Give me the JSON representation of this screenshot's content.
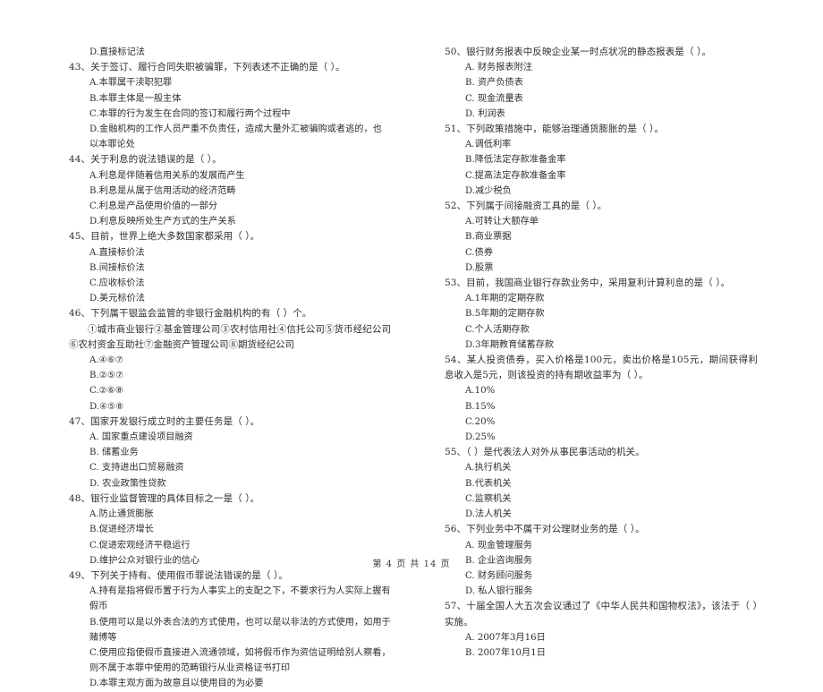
{
  "document": {
    "footer": "第 4 页  共 14 页",
    "page_number": "4",
    "total_pages": "14"
  },
  "left_column": {
    "orphan_option": "D.直接标记法",
    "questions": [
      {
        "number": "43、",
        "stem": "关于签订、履行合同失职被骗罪，下列表述不正确的是（      ）。",
        "options": [
          "A.本罪属干渎职犯罪",
          "B.本罪主体是一般主体",
          "C.本罪的行为发生在合同的签订和履行两个过程中",
          "D.金融机构的工作人员严重不负责任，造成大量外汇被骗购或者逃的，也以本罪论处"
        ]
      },
      {
        "number": "44、",
        "stem": "关于利息的说法错误的是（      ）。",
        "options": [
          "A.利息是伴随着信用关系的发展而产生",
          "B.利息是从属于信用活动的经济范畴",
          "C.利息是产品使用价值的一部分",
          "D.利息反映所处生产方式的生产关系"
        ]
      },
      {
        "number": "45、",
        "stem": "目前，世界上绝大多数国家都采用（      ）。",
        "options": [
          "A.直接标价法",
          "B.间接标价法",
          "C.应收标价法",
          "D.美元标价法"
        ]
      },
      {
        "number": "46、",
        "stem": "下列属干银监会监管的非银行金融机构的有（      ）个。",
        "sub": "①城市商业银行②基金管理公司③农村信用社④信托公司⑤货币经纪公司⑥农村资金互助社⑦金融资产管理公司⑧期货经纪公司",
        "options": [
          "A.④⑥⑦",
          "B.②⑤⑦",
          "C.②⑥⑧",
          "D.④⑤⑧"
        ]
      },
      {
        "number": "47、",
        "stem": "国家开发银行成立时的主要任务是（      ）。",
        "options": [
          "A.  国家重点建设项目融资",
          "B.  储蓄业务",
          "C.  支持进出口贸易融资",
          "D.  农业政策性贷款"
        ]
      },
      {
        "number": "48、",
        "stem": "银行业监督管理的具体目标之一是（      ）。",
        "options": [
          "A.防止通货膨胀",
          "B.促进经济增长",
          "C.促进宏观经济平稳运行",
          "D.维护公众对银行业的信心"
        ]
      },
      {
        "number": "49、",
        "stem": "下列关于持有、使用假币罪说法错误的是（      ）。",
        "options": [
          "A.持有是指将假币置于行为人事实上的支配之下，不要求行为人实际上握有假币",
          "B.使用可以是以外表合法的方式使用，也可以是以非法的方式使用，如用于赌博等",
          "C.使用应指使假币直接进入流通领域，如将假币作为资信证明给别人察看，则不属于本罪中使用的范畴银行从业资格证书打印",
          "D.本罪主观方面为故意且以使用目的为必要"
        ]
      }
    ]
  },
  "right_column": {
    "questions": [
      {
        "number": "50、",
        "stem": "银行财务报表中反映企业某一时点状况的静态报表是（      ）。",
        "options": [
          "A.  财务报表附注",
          "B.  资产负债表",
          "C.  现金流量表",
          "D.  利润表"
        ]
      },
      {
        "number": "51、",
        "stem": "下列政策措施中，能够治理通货膨胀的是（      ）。",
        "options": [
          "A.调低利率",
          "B.降低法定存款准备金率",
          "C.提高法定存款准备金率",
          "D.减少税负"
        ]
      },
      {
        "number": "52、",
        "stem": "下列属于间接融资工具的是（      ）。",
        "options": [
          "A.可转让大额存单",
          "B.商业票据",
          "C.债券",
          "D.股票"
        ]
      },
      {
        "number": "53、",
        "stem": "目前，我国商业银行存款业务中，采用复利计算利息的是（      ）。",
        "options": [
          "A.1年期的定期存款",
          "B.5年期的定期存款",
          "C.个人活期存款",
          "D.3年期教育储蓄存款"
        ]
      },
      {
        "number": "54、",
        "stem": "某人投资债券，买入价格是100元，卖出价格是105元，期间获得利息收入是5元，则该投资的持有期收益率为（      ）。",
        "options": [
          "A.10%",
          "B.15%",
          "C.20%",
          "D.25%"
        ]
      },
      {
        "number": "55、",
        "stem": "（      ）是代表法人对外从事民事活动的机关。",
        "options": [
          "A.执行机关",
          "B.代表机关",
          "C.监察机关",
          "D.法人机关"
        ]
      },
      {
        "number": "56、",
        "stem": "下列业务中不属干对公理财业务的是（      ）。",
        "options": [
          "A.  现金管理服务",
          "B.  企业咨询服务",
          "C.  财务顾问服务",
          "D.  私人银行服务"
        ]
      },
      {
        "number": "57、",
        "stem": "十届全国人大五次会议通过了《中华人民共和国物权法》，该法于（      ）实施。",
        "options": [
          "A.  2007年3月16日",
          "B.  2007年10月1日"
        ]
      }
    ]
  }
}
